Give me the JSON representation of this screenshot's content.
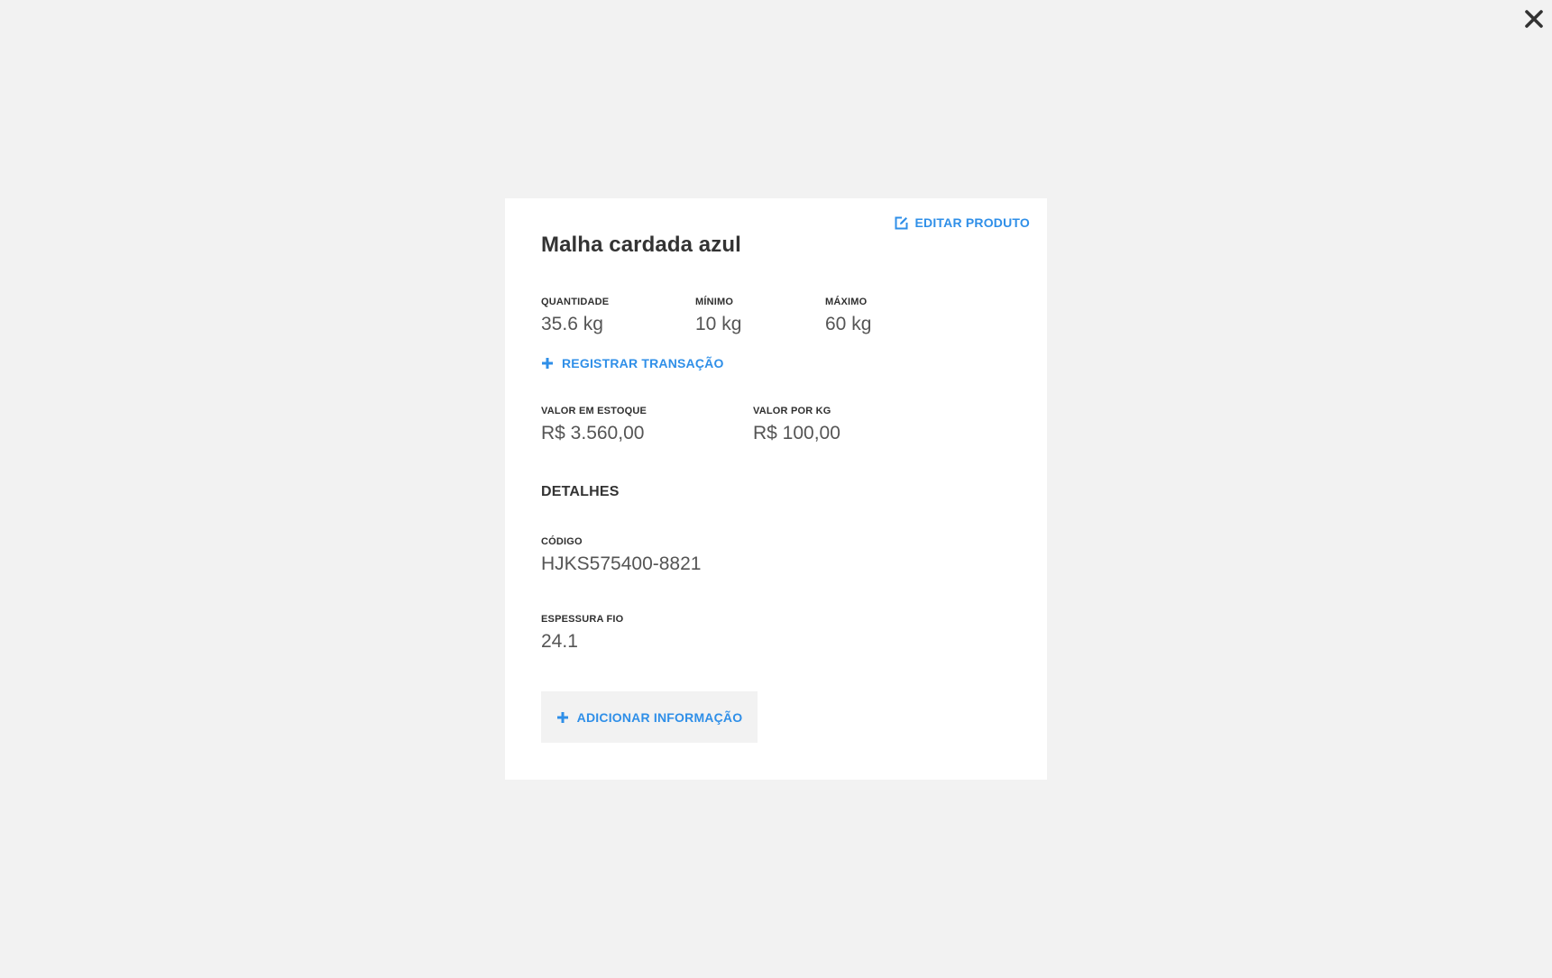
{
  "close_icon": "close-icon",
  "modal": {
    "title": "Malha cardada azul",
    "edit_label": "EDITAR PRODUTO",
    "stock": {
      "quantity_label": "QUANTIDADE",
      "quantity_value": "35.6 kg",
      "min_label": "MÍNIMO",
      "min_value": "10 kg",
      "max_label": "MÁXIMO",
      "max_value": "60 kg"
    },
    "register_transaction_label": "REGISTRAR TRANSAÇÃO",
    "value": {
      "stock_value_label": "VALOR EM ESTOQUE",
      "stock_value": "R$ 3.560,00",
      "per_kg_label": "VALOR POR KG",
      "per_kg_value": "R$ 100,00"
    },
    "details": {
      "section_title": "DETALHES",
      "fields": [
        {
          "label": "CÓDIGO",
          "value": "HJKS575400-8821"
        },
        {
          "label": "ESPESSURA FIO",
          "value": "24.1"
        }
      ]
    },
    "add_info_label": "ADICIONAR INFORMAÇÃO"
  },
  "colors": {
    "accent": "#2f8fe8",
    "background": "#f2f2f2",
    "card": "#ffffff",
    "text": "#333333"
  }
}
